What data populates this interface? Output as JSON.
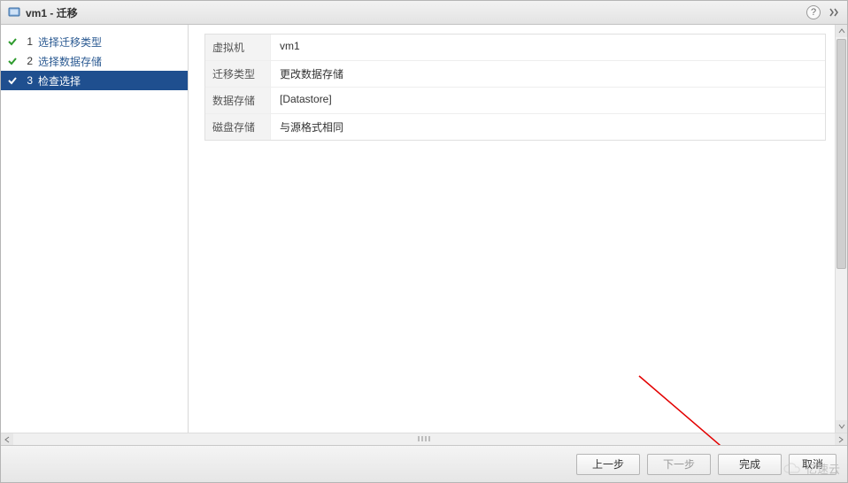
{
  "title": {
    "vm": "vm1",
    "sep": " - ",
    "action": "迁移"
  },
  "icons": {
    "title": "vm-icon",
    "help": "help-icon",
    "expand": "expand-icon"
  },
  "steps": [
    {
      "num": "1",
      "label": "选择迁移类型",
      "state": "done"
    },
    {
      "num": "2",
      "label": "选择数据存储",
      "state": "done"
    },
    {
      "num": "3",
      "label": "检查选择",
      "state": "active"
    }
  ],
  "summary": [
    {
      "key": "虚拟机",
      "value": "vm1"
    },
    {
      "key": "迁移类型",
      "value": "更改数据存储"
    },
    {
      "key": "数据存储",
      "value": "[Datastore]"
    },
    {
      "key": "磁盘存储",
      "value": "与源格式相同"
    }
  ],
  "buttons": {
    "back": "上一步",
    "next": "下一步",
    "finish": "完成",
    "cancel": "取消"
  },
  "watermark": "亿速云",
  "help_glyph": "?"
}
